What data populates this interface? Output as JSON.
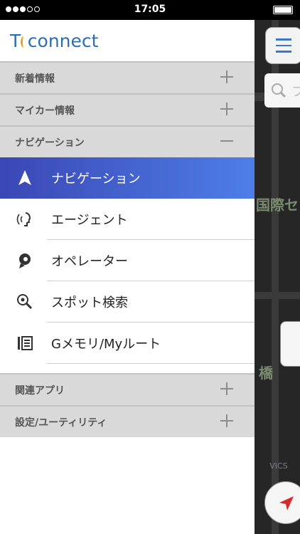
{
  "status": {
    "time": "17:05"
  },
  "logo": {
    "prefix": "T",
    "rest": "connect"
  },
  "categories": [
    {
      "label": "新着情報",
      "state": "collapsed"
    },
    {
      "label": "マイカー情報",
      "state": "collapsed"
    },
    {
      "label": "ナビゲーション",
      "state": "expanded"
    }
  ],
  "nav_items": [
    {
      "label": "ナビゲーション",
      "icon": "navigation-arrow-icon",
      "active": true
    },
    {
      "label": "エージェント",
      "icon": "voice-agent-icon",
      "active": false
    },
    {
      "label": "オペレーター",
      "icon": "operator-icon",
      "active": false
    },
    {
      "label": "スポット検索",
      "icon": "spot-search-icon",
      "active": false
    },
    {
      "label": "Gメモリ/Myルート",
      "icon": "gmemory-route-icon",
      "active": false
    }
  ],
  "bottom_categories": [
    {
      "label": "関連アプリ",
      "state": "collapsed"
    },
    {
      "label": "設定/ユーティリティ",
      "state": "collapsed"
    }
  ],
  "map": {
    "search_placeholder": "フ",
    "labels": [
      "国際セン",
      "橋",
      "VICS"
    ]
  },
  "colors": {
    "accent": "#2c6db4",
    "active_start": "#3a47b4",
    "active_end": "#4e7ee8"
  }
}
